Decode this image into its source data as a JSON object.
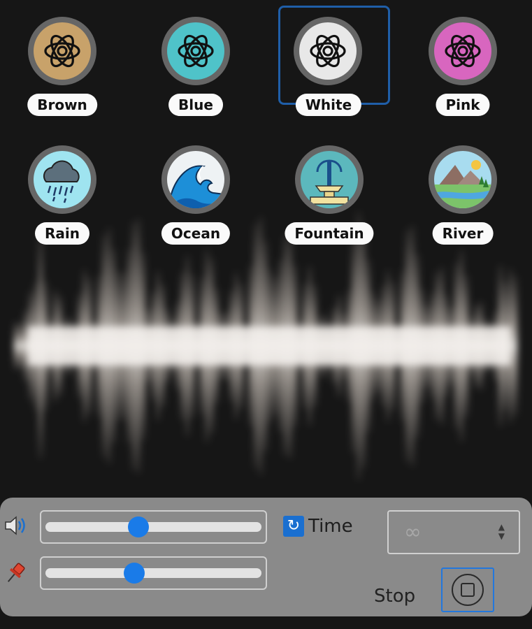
{
  "sounds": [
    {
      "label": "Brown",
      "icon": "atom-icon",
      "color": "#c8a26a"
    },
    {
      "label": "Blue",
      "icon": "atom-icon",
      "color": "#4fc3c9"
    },
    {
      "label": "White",
      "icon": "atom-icon",
      "color": "#e8e8e8"
    },
    {
      "label": "Pink",
      "icon": "atom-icon",
      "color": "#d866bf"
    },
    {
      "label": "Rain",
      "icon": "rain-cloud-icon",
      "color": "#9fe4f0"
    },
    {
      "label": "Ocean",
      "icon": "ocean-wave-icon",
      "color": "#eef2f4"
    },
    {
      "label": "Fountain",
      "icon": "fountain-icon",
      "color": "#5cb8bd"
    },
    {
      "label": "River",
      "icon": "river-landscape-icon",
      "color": "#a8dcef"
    }
  ],
  "selected_sound": "White",
  "controls": {
    "volume": {
      "icon": "speaker-icon",
      "value": 0.43
    },
    "balance": {
      "icon": "pin-icon",
      "value": 0.41
    },
    "time": {
      "label": "Time",
      "checked": true,
      "icon": "refresh-icon"
    },
    "duration_select": {
      "value": "∞"
    },
    "stop": {
      "label": "Stop",
      "icon": "stop-icon"
    }
  },
  "colors": {
    "accent": "#1a7be8",
    "panel": "#8a8a8a",
    "selection": "#1f5ea8"
  }
}
